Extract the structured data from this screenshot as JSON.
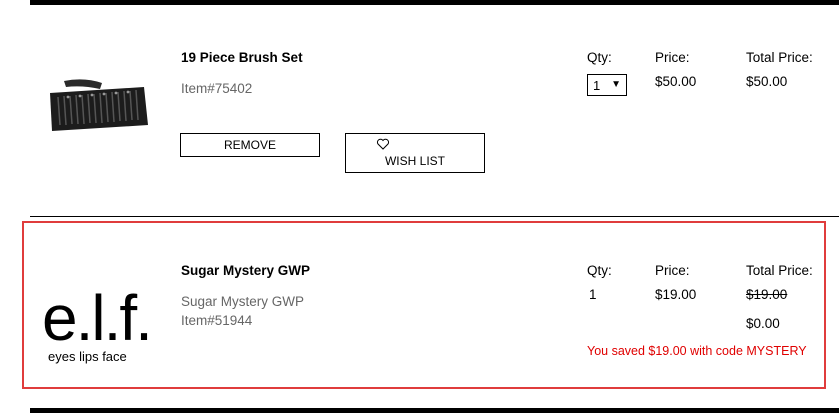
{
  "items": [
    {
      "name": "19 Piece Brush Set",
      "item_number": "Item#75402",
      "qty_label": "Qty:",
      "qty_value": "1",
      "price_label": "Price:",
      "price": "$50.00",
      "total_label": "Total Price:",
      "total": "$50.00",
      "remove_label": "REMOVE",
      "wishlist_label": "WISH LIST"
    },
    {
      "name": "Sugar Mystery GWP",
      "subtitle": "Sugar Mystery GWP",
      "item_number": "Item#51944",
      "qty_label": "Qty:",
      "qty_value": "1",
      "price_label": "Price:",
      "price": "$19.00",
      "total_label": "Total Price:",
      "original_total": "$19.00",
      "total": "$0.00",
      "savings_message": "You saved $19.00 with code MYSTERY",
      "logo_wordmark": "e.l.f.",
      "logo_tagline": "eyes lips face"
    }
  ],
  "colors": {
    "highlight_border": "#e03c3c",
    "savings_text": "#e00000",
    "muted_text": "#666666"
  },
  "icons": {
    "wishlist": "heart-outline-icon",
    "qty_dropdown": "triangle-down-icon"
  }
}
